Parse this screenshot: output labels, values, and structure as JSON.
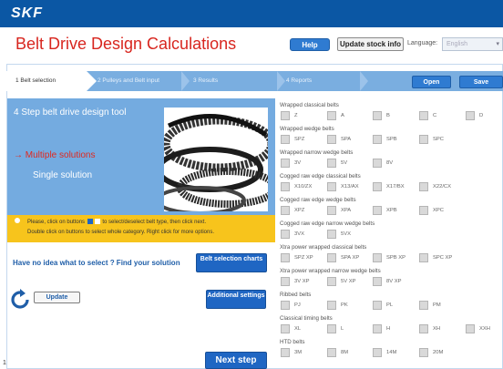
{
  "header": {
    "brand": "SKF"
  },
  "app": {
    "title": "Belt Drive Design Calculations"
  },
  "toolbar": {
    "help_label": "Help",
    "stock_label": "Update stock info",
    "language_label": "Language:",
    "language_value": "English"
  },
  "steps": [
    {
      "label": "1  Belt selection"
    },
    {
      "label": "2  Pulleys and Belt input"
    },
    {
      "label": "3  Results"
    },
    {
      "label": "4  Reports"
    }
  ],
  "actions": {
    "open_label": "Open",
    "save_label": "Save"
  },
  "intro": {
    "heading": "4 Step belt drive design tool",
    "multiple_label": "Multiple solutions",
    "single_label": "Single solution"
  },
  "hint": {
    "line1_a": "Please, click on buttons",
    "line1_b": "to select/deselect belt type, then click next.",
    "line2": "Double click on buttons to select whole category. Right click for more options."
  },
  "help": {
    "question": "Have no idea what to select ? Find your solution",
    "belt_charts_label": "Belt selection charts",
    "additional_label": "Additional settings",
    "update_label": "Update",
    "next_label": "Next step"
  },
  "page_number": "1",
  "categories": [
    {
      "label": "Wrapped classical belts",
      "items": [
        "Z",
        "A",
        "B",
        "C",
        "D"
      ]
    },
    {
      "label": "Wrapped wedge belts",
      "items": [
        "SPZ",
        "SPA",
        "SPB",
        "SPC"
      ]
    },
    {
      "label": "Wrapped narrow wedge belts",
      "items": [
        "3V",
        "5V",
        "8V"
      ]
    },
    {
      "label": "Cogged raw edge classical belts",
      "items": [
        "X10/ZX",
        "X13/AX",
        "X17/BX",
        "X22/CX"
      ]
    },
    {
      "label": "Cogged raw edge wedge belts",
      "items": [
        "XPZ",
        "XPA",
        "XPB",
        "XPC"
      ]
    },
    {
      "label": "Cogged raw edge narrow wedge belts",
      "items": [
        "3VX",
        "5VX"
      ]
    },
    {
      "label": "Xtra power wrapped classical belts",
      "items": [
        "SPZ XP",
        "SPA XP",
        "SPB XP",
        "SPC XP"
      ]
    },
    {
      "label": "Xtra power wrapped narrow wedge belts",
      "items": [
        "3V XP",
        "5V XP",
        "8V XP"
      ]
    },
    {
      "label": "Ribbed belts",
      "items": [
        "PJ",
        "PK",
        "PL",
        "PM"
      ]
    },
    {
      "label": "Classical timing belts",
      "items": [
        "XL",
        "L",
        "H",
        "XH",
        "XXH"
      ]
    },
    {
      "label": "HTD belts",
      "items": [
        "3M",
        "8M",
        "14M",
        "20M"
      ]
    }
  ],
  "colors": {
    "brand_blue": "#0b57a4",
    "title_red": "#d8261f",
    "panel_blue": "#74abe0",
    "hint_yellow": "#f7c41c",
    "button_blue": "#1f66c3"
  }
}
